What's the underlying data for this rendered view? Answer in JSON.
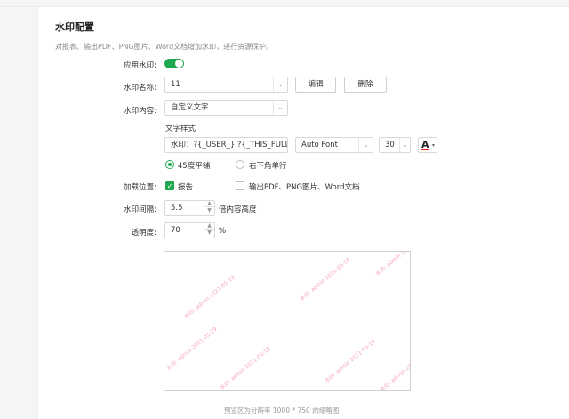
{
  "section": {
    "title": "水印配置",
    "description": "对报表、输出PDF、PNG图片、Word文档增加水印，进行资源保护。"
  },
  "labels": {
    "apply": "应用水印:",
    "name": "水印名称:",
    "content": "水印内容:",
    "text_style": "文字样式",
    "position": "加载位置:",
    "interval": "水印间隔:",
    "opacity": "透明度:"
  },
  "apply_toggle": {
    "on": true
  },
  "name_field": {
    "value": "11"
  },
  "buttons": {
    "edit": "编辑",
    "delete": "删除"
  },
  "content_select": {
    "value": "自定义文字"
  },
  "text_style": {
    "text_value": "水印：?{_USER_} ?{_THIS_FULL_DAY}",
    "font": "Auto Font",
    "size": "30",
    "color_glyph": "A",
    "color": "#e02020"
  },
  "layout_options": [
    {
      "label": "45度平铺",
      "selected": true
    },
    {
      "label": "右下角单行",
      "selected": false
    }
  ],
  "position_options": [
    {
      "label": "报告",
      "checked": true
    },
    {
      "label": "输出PDF、PNG图片、Word文档",
      "checked": false
    }
  ],
  "interval": {
    "value": "5.5",
    "unit": "倍内容高度"
  },
  "opacity": {
    "value": "70",
    "unit": "%"
  },
  "preview": {
    "watermark_text": "水印: admin 2021-05-19",
    "caption": "预览区为分辨率 1000 * 750 的缩略图"
  },
  "colors": {
    "accent": "#1fa84f",
    "watermark": "#f5a6b8"
  }
}
